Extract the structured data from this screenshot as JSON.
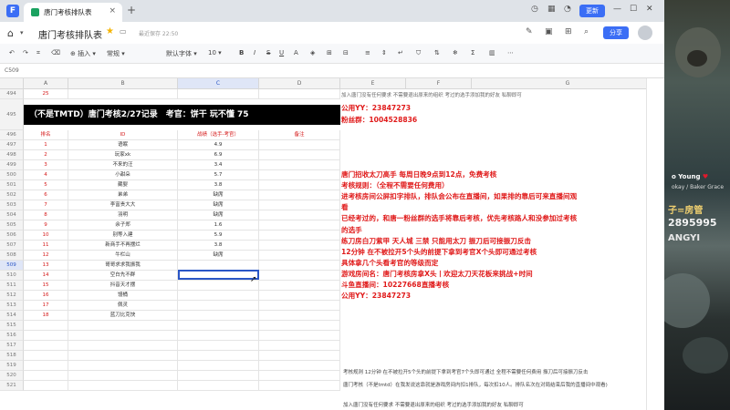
{
  "browser": {
    "logo": "F",
    "tab_title": "唐门考核排队表",
    "tab_close": "×",
    "new_tab": "+",
    "upgrade": "更新"
  },
  "doc": {
    "title": "唐门考核排队表",
    "save_status": "最近保存 22:50",
    "share": "分享"
  },
  "toolbar": {
    "insert": "插入",
    "style": "常规",
    "font": "默认字体",
    "font_size": "10",
    "bold": "B",
    "italic": "I",
    "strike": "S",
    "underline": "U",
    "fill": "A"
  },
  "cell_ref": "C509",
  "columns": [
    "A",
    "B",
    "C",
    "D",
    "E",
    "F",
    "G"
  ],
  "top_row": {
    "num": "494",
    "a": "25"
  },
  "sheet_title": "（不是TMTD）唐门考核2/27记录　考官：饼干 玩不懂 75",
  "header_row": {
    "num": "496",
    "a": "排名",
    "b": "ID",
    "c": "战绩（选手-考官）",
    "d": "备注"
  },
  "rows": [
    {
      "num": "497",
      "a": "1",
      "b": "语眠",
      "c": "4.9"
    },
    {
      "num": "498",
      "a": "2",
      "b": "玩家xk",
      "c": "6.9"
    },
    {
      "num": "499",
      "a": "3",
      "b": "不来的汪",
      "c": "3.4"
    },
    {
      "num": "500",
      "a": "4",
      "b": "小甜朵",
      "c": "5.7"
    },
    {
      "num": "501",
      "a": "5",
      "b": "藏婴",
      "c": "3.8"
    },
    {
      "num": "502",
      "a": "6",
      "b": "弟弟",
      "c": "缺席"
    },
    {
      "num": "503",
      "a": "7",
      "b": "李富贵大大",
      "c": "缺席"
    },
    {
      "num": "504",
      "a": "8",
      "b": "羽明",
      "c": "缺席"
    },
    {
      "num": "505",
      "a": "9",
      "b": "余子郑",
      "c": "1.6"
    },
    {
      "num": "506",
      "a": "10",
      "b": "别等入建",
      "c": "5.9"
    },
    {
      "num": "507",
      "a": "11",
      "b": "新商手不再摆烂",
      "c": "3.8"
    },
    {
      "num": "508",
      "a": "12",
      "b": "牛栏山",
      "c": "缺席"
    },
    {
      "num": "509",
      "a": "13",
      "b": "哥哥求求我振我",
      "c": ""
    },
    {
      "num": "510",
      "a": "14",
      "b": "空白先不群",
      "c": ""
    },
    {
      "num": "511",
      "a": "15",
      "b": "抖音天才摆",
      "c": ""
    },
    {
      "num": "512",
      "a": "16",
      "b": "馒桶",
      "c": ""
    },
    {
      "num": "513",
      "a": "17",
      "b": "佩灵",
      "c": ""
    },
    {
      "num": "514",
      "a": "18",
      "b": "蓝刀比克快",
      "c": ""
    },
    {
      "num": "515",
      "a": "",
      "b": "",
      "c": ""
    },
    {
      "num": "516",
      "a": "",
      "b": "",
      "c": ""
    },
    {
      "num": "517",
      "a": "",
      "b": "",
      "c": ""
    },
    {
      "num": "518",
      "a": "",
      "b": "",
      "c": ""
    },
    {
      "num": "519",
      "a": "",
      "b": "",
      "c": ""
    },
    {
      "num": "520",
      "a": "",
      "b": "",
      "c": ""
    },
    {
      "num": "521",
      "a": "",
      "b": "",
      "c": ""
    }
  ],
  "row_495": "495",
  "notes_top": {
    "gray1": "加入唐门没有任何要求 不需要退出原来的组织 考过的选手添加我的好友 私聊即可",
    "contact1": "公用YY：23847273",
    "contact2": "粉丝群：1004528836"
  },
  "notes_red": [
    "唐门招收太刀高手 每周日晚9点到12点，免费考核",
    "考核规则：（全程不需要任何费用）",
    "进考核房间公屏扣字排队，排队会公布在直播间，如果排的靠后可来直播间观",
    "看",
    "已经考过的，和唐一粉丝群的选手将靠后考核，优先考核路人和没参加过考核",
    "的选手",
    "练刀房白刀紫甲 天人城 三禁 只能用太刀 振刀后可接振刀反击",
    "12分钟 在不被拉开5个头的前提下拿到考官X个头即可通过考核",
    "具体拿几个头看考官的等级而定",
    "游戏房间名：唐门考核房拿X头丨欢迎太刀天花板来挑战+时间",
    "斗鱼直播间：10227668直播考核",
    "公用YY：23847273"
  ],
  "notes_bottom": [
    "考核规则 12分钟 在不被拉开5个头的前提下拿到考官7个头即可通过 全程不需要任何费用 振刀后可接振刀反击",
    "唐门考核（不是tmtd）在我发说这靠就是游戏房间内扣1排队，每次扣10人。排队名次在对局结束后我的直播间中观看)",
    "加入唐门没有任何要求 不需要退出原来的组织 考过的选手添加我的好友 私聊即可"
  ],
  "stream": {
    "name1": "o Young",
    "name2": "okay / Baker Grace",
    "line1": "子=房管",
    "line2": "2895995",
    "line3": "ANGYI"
  }
}
